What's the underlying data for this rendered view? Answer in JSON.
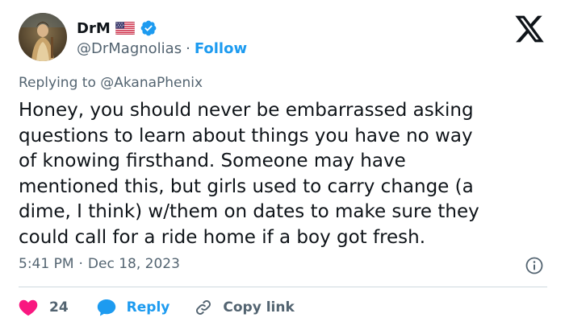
{
  "author": {
    "display_name": "DrM",
    "handle": "@DrMagnolias",
    "follow_label": "Follow",
    "separator": "·",
    "flag_icon": "us-flag-icon",
    "verified_icon": "verified-badge-icon"
  },
  "platform": {
    "logo_icon": "x-logo-icon"
  },
  "reply_context": {
    "prefix": "Replying to",
    "handle": "@AkanaPhenix"
  },
  "tweet": {
    "lines": [
      "Honey, you should never be embarrassed asking",
      "questions to learn about things you have no way",
      "of knowing firsthand. Someone may have",
      "mentioned this, but girls used to carry change (a",
      "dime, I think) w/them on dates to make sure they",
      "could call for a ride home if a boy got fresh."
    ],
    "time": "5:41 PM",
    "separator": "·",
    "date": "Dec 18, 2023"
  },
  "actions": {
    "like_count": "24",
    "reply_label": "Reply",
    "copy_link_label": "Copy link"
  },
  "colors": {
    "accent": "#1d9bf0",
    "like": "#f91880",
    "text": "#0f1419",
    "muted": "#536471",
    "divider": "#cfd9de"
  }
}
